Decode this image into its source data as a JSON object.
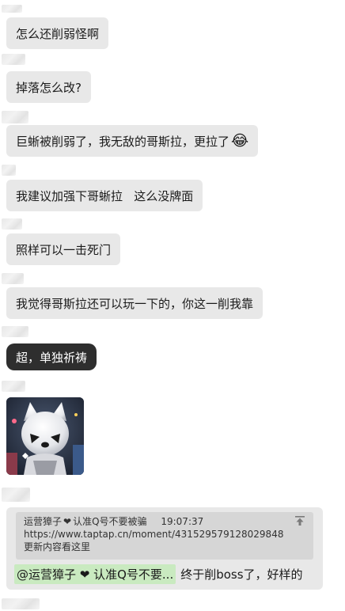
{
  "messages": [
    {
      "text": "怎么还削弱怪啊"
    },
    {
      "text": "掉落怎么改?"
    },
    {
      "text": "巨蜥被削弱了，我无敌的哥斯拉，更拉了"
    },
    {
      "text": "我建议加强下哥蜥拉   这么没牌面"
    },
    {
      "text": "照样可以一击死门"
    },
    {
      "text": "我觉得哥斯拉还可以玩一下的，你这一削我靠"
    },
    {
      "text": "超，单独祈祷"
    }
  ],
  "quote": {
    "author": "运营獐子",
    "heart": "❤",
    "author_suffix": "认准Q号不要被骗",
    "time": "19:07:37",
    "url": "https://www.taptap.cn/moment/431529579128029848",
    "body": "更新内容看这里"
  },
  "reply": {
    "mention": "@运营獐子 ❤ 认准Q号不要...",
    "text": "终于削boss了，好样的"
  },
  "icons": {
    "crying_laughing": "😂",
    "pin": "pin-icon"
  }
}
